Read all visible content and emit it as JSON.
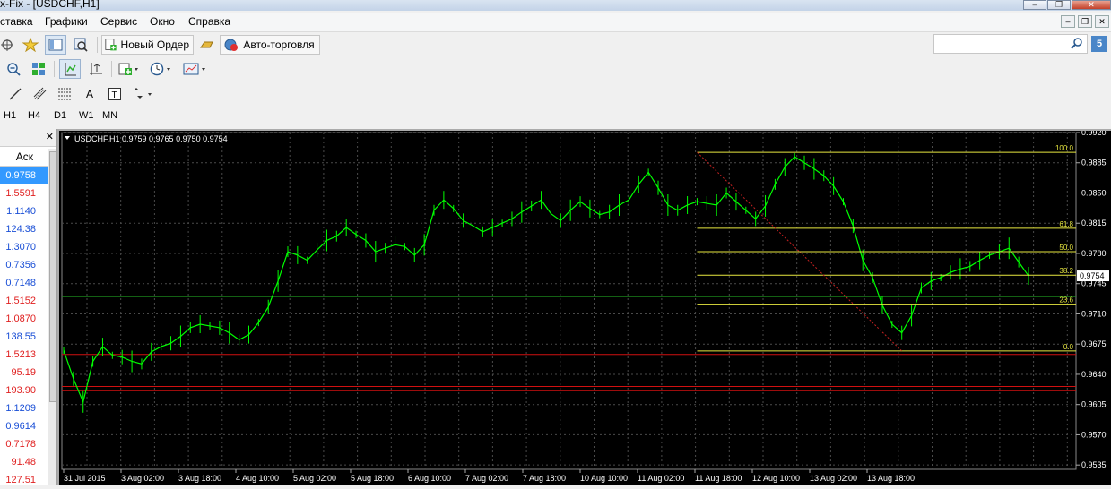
{
  "window": {
    "title": "x-Fix - [USDCHF,H1]"
  },
  "menu": [
    "ставка",
    "Графики",
    "Сервис",
    "Окно",
    "Справка"
  ],
  "toolbar": {
    "new_order_label": "Новый Ордер",
    "autotrade_label": "Авто-торговля"
  },
  "search": {
    "placeholder": ""
  },
  "notifications_badge": "5",
  "timeframes": [
    "H1",
    "H4",
    "D1",
    "W1",
    "MN"
  ],
  "market_watch": {
    "column_header": "Аск",
    "rows": [
      {
        "value": "0.9758",
        "dir": "sel"
      },
      {
        "value": "1.5591",
        "dir": "dn"
      },
      {
        "value": "1.1140",
        "dir": "up"
      },
      {
        "value": "124.38",
        "dir": "up"
      },
      {
        "value": "1.3070",
        "dir": "up"
      },
      {
        "value": "0.7356",
        "dir": "up"
      },
      {
        "value": "0.7148",
        "dir": "up"
      },
      {
        "value": "1.5152",
        "dir": "dn"
      },
      {
        "value": "1.0870",
        "dir": "dn"
      },
      {
        "value": "138.55",
        "dir": "up"
      },
      {
        "value": "1.5213",
        "dir": "dn"
      },
      {
        "value": "95.19",
        "dir": "dn"
      },
      {
        "value": "193.90",
        "dir": "dn"
      },
      {
        "value": "1.1209",
        "dir": "up"
      },
      {
        "value": "0.9614",
        "dir": "up"
      },
      {
        "value": "0.7178",
        "dir": "dn"
      },
      {
        "value": "91.48",
        "dir": "dn"
      },
      {
        "value": "127.51",
        "dir": "dn"
      }
    ]
  },
  "chart_info": "USDCHF,H1  0.9759 0.9765 0.9750 0.9754",
  "current_price": "0.9754",
  "colors": {
    "candle": "#00ff00",
    "fib": "#e8e840",
    "hline_red": "#d01010",
    "hline_green": "#1f9a1f",
    "grid": "#4a4a4a",
    "axis_text": "#ffffff"
  },
  "chart_data": {
    "type": "line",
    "ylim": [
      0.953,
      0.992
    ],
    "yticks": [
      0.992,
      0.9885,
      0.985,
      0.9815,
      0.978,
      0.9745,
      0.971,
      0.9675,
      0.964,
      0.9605,
      0.957,
      0.9535
    ],
    "x_labels": [
      "31 Jul 2015",
      "3 Aug 02:00",
      "3 Aug 18:00",
      "4 Aug 10:00",
      "5 Aug 02:00",
      "5 Aug 18:00",
      "6 Aug 10:00",
      "7 Aug 02:00",
      "7 Aug 18:00",
      "10 Aug 10:00",
      "11 Aug 02:00",
      "11 Aug 18:00",
      "12 Aug 10:00",
      "13 Aug 02:00",
      "13 Aug 18:00"
    ],
    "series": [
      {
        "values": [
          0.9668,
          0.9635,
          0.9608,
          0.9655,
          0.9672,
          0.9662,
          0.966,
          0.9655,
          0.9652,
          0.9666,
          0.9672,
          0.9676,
          0.9684,
          0.9694,
          0.9698,
          0.9696,
          0.9694,
          0.9688,
          0.968,
          0.9686,
          0.97,
          0.9718,
          0.9748,
          0.9782,
          0.9778,
          0.9772,
          0.9784,
          0.9795,
          0.98,
          0.981,
          0.9802,
          0.9795,
          0.9782,
          0.9786,
          0.979,
          0.9788,
          0.9778,
          0.979,
          0.983,
          0.9842,
          0.9832,
          0.9818,
          0.9812,
          0.9805,
          0.981,
          0.9815,
          0.982,
          0.9828,
          0.9835,
          0.9842,
          0.9826,
          0.9818,
          0.983,
          0.984,
          0.9832,
          0.9825,
          0.9828,
          0.9836,
          0.9842,
          0.986,
          0.9874,
          0.9856,
          0.9836,
          0.983,
          0.9836,
          0.984,
          0.9838,
          0.9836,
          0.985,
          0.984,
          0.983,
          0.982,
          0.9835,
          0.986,
          0.988,
          0.9892,
          0.9885,
          0.9878,
          0.987,
          0.9858,
          0.984,
          0.9812,
          0.9772,
          0.9752,
          0.972,
          0.9698,
          0.9688,
          0.9708,
          0.974,
          0.9748,
          0.9752,
          0.9758,
          0.9762,
          0.9765,
          0.9772,
          0.9778,
          0.9782,
          0.9786,
          0.977,
          0.9754
        ]
      }
    ],
    "horizontal_lines": [
      {
        "price": 0.973,
        "color": "green"
      },
      {
        "price": 0.9663,
        "color": "red"
      },
      {
        "price": 0.9626,
        "color": "red"
      },
      {
        "price": 0.9621,
        "color": "red"
      }
    ],
    "fibonacci": {
      "levels": [
        "100.0",
        "61.8",
        "50.0",
        "38.2",
        "23.6",
        "0.0"
      ],
      "high": 0.9897,
      "low": 0.9667
    }
  }
}
